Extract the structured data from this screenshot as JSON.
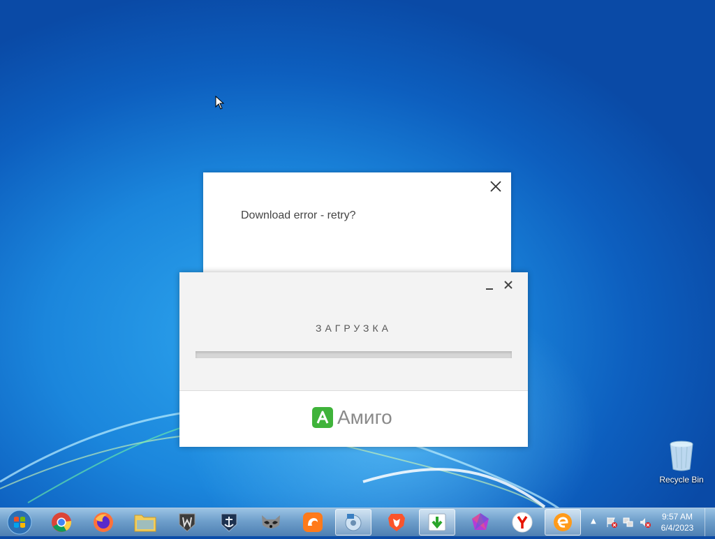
{
  "error_dialog": {
    "message": "Download error - retry?"
  },
  "amigo_installer": {
    "status_label": "ЗАГРУЗКА",
    "progress": 0,
    "brand_name": "Амиго",
    "brand_color": "#3fb33a"
  },
  "desktop": {
    "icons": [
      {
        "label": "Recycle Bin",
        "icon": "recycle-bin-icon"
      }
    ]
  },
  "taskbar": {
    "pinned": [
      {
        "name": "chrome",
        "icon": "chrome-icon"
      },
      {
        "name": "firefox",
        "icon": "firefox-icon"
      },
      {
        "name": "explorer",
        "icon": "folder-icon"
      },
      {
        "name": "world-of-tanks",
        "icon": "tanks-icon"
      },
      {
        "name": "world-of-warships",
        "icon": "warships-icon"
      },
      {
        "name": "raccoon",
        "icon": "raccoon-icon"
      },
      {
        "name": "uc-browser",
        "icon": "uc-browser-icon"
      },
      {
        "name": "media-center",
        "icon": "media-icon"
      },
      {
        "name": "brave",
        "icon": "brave-icon"
      },
      {
        "name": "download-master",
        "icon": "download-icon"
      },
      {
        "name": "crystal",
        "icon": "crystal-icon"
      },
      {
        "name": "yandex",
        "icon": "yandex-icon"
      },
      {
        "name": "amigo",
        "icon": "amigo-icon"
      }
    ],
    "clock": {
      "time": "9:57 AM",
      "date": "6/4/2023"
    }
  }
}
